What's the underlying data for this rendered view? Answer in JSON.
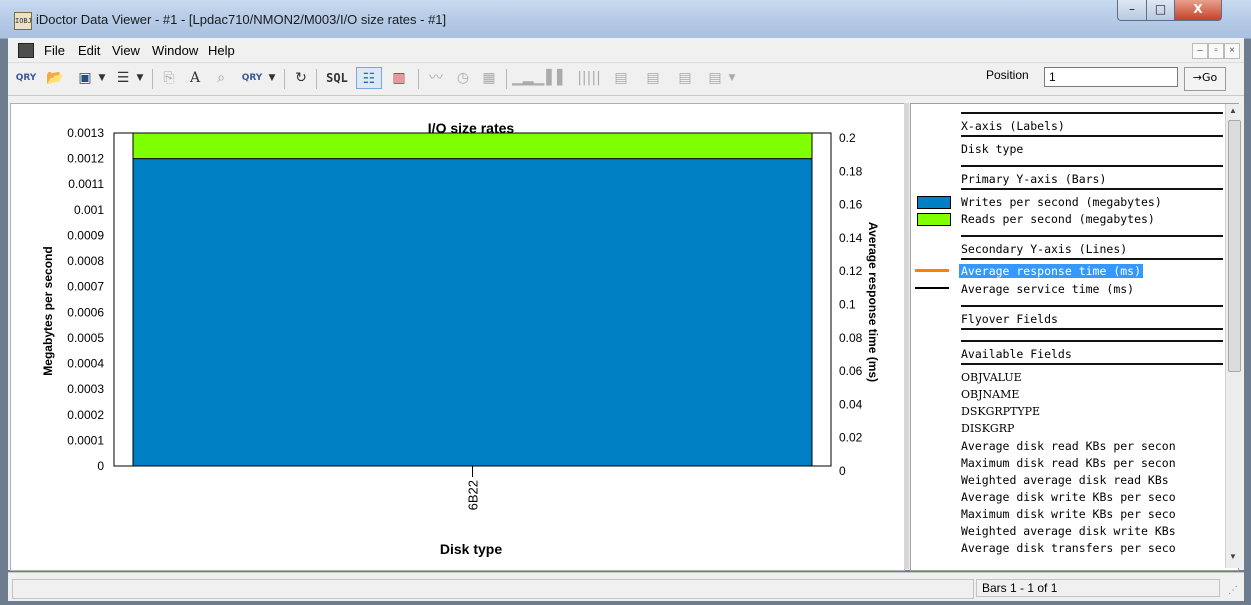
{
  "window": {
    "app_icon_text": "IOBJ",
    "title": "iDoctor Data Viewer - #1 - [Lpdac710/NMON2/M003/I/O size rates - #1]",
    "minimize": "–",
    "maximize": "□",
    "close": "X"
  },
  "menu": [
    "File",
    "Edit",
    "View",
    "Window",
    "Help"
  ],
  "mdi_controls": [
    "–",
    "̅❐",
    "×"
  ],
  "toolbar": {
    "sql_label": "SQL",
    "position_label": "Position",
    "position_value": "1",
    "go_label": "→Go"
  },
  "chart_data": {
    "type": "bar",
    "title": "I/O size rates",
    "categories": [
      "6B22"
    ],
    "series": [
      {
        "name": "Writes per second (megabytes)",
        "values": [
          0.0012
        ],
        "color": "#0080c4"
      },
      {
        "name": "Reads per second (megabytes)",
        "values": [
          0.0001
        ],
        "color": "#80ff00"
      }
    ],
    "stacked": true,
    "xlabel": "Disk type",
    "ylabel": "Megabytes per second",
    "y2label": "Average response time (ms)",
    "ylim": [
      0,
      0.0013
    ],
    "y_ticks": [
      "0",
      "0.0001",
      "0.0002",
      "0.0003",
      "0.0004",
      "0.0005",
      "0.0006",
      "0.0007",
      "0.0008",
      "0.0009",
      "0.001",
      "0.0011",
      "0.0012",
      "0.0013"
    ],
    "y2lim": [
      0,
      0.2
    ],
    "y2_ticks": [
      "0",
      "0.02",
      "0.04",
      "0.06",
      "0.08",
      "0.1",
      "0.12",
      "0.14",
      "0.16",
      "0.18",
      "0.2"
    ],
    "legend_placement": "right panel",
    "grid": false
  },
  "legend": {
    "x_axis_header": "X-axis (Labels)",
    "x_axis_value": "Disk type",
    "primary_header": "Primary Y-axis (Bars)",
    "bar_items": [
      {
        "label": "Writes per second (megabytes)",
        "color": "#0080c4"
      },
      {
        "label": "Reads per second (megabytes)",
        "color": "#80ff00"
      }
    ],
    "secondary_header": "Secondary Y-axis (Lines)",
    "line_items": [
      {
        "label": "Average response time (ms)",
        "color": "#ff8000",
        "selected": true
      },
      {
        "label": "Average service time (ms)",
        "color": "#000000",
        "selected": false
      }
    ],
    "flyover_header": "Flyover Fields",
    "available_header": "Available Fields",
    "available_fields": [
      "OBJVALUE",
      "OBJNAME",
      "DSKGRPTYPE",
      "DISKGRP",
      "Average disk read KBs per secon",
      "Maximum disk read KBs per secon",
      "Weighted average disk read KBs ",
      "Average disk write KBs per seco",
      "Maximum disk write KBs per seco",
      "Weighted average disk write KBs",
      "Average disk transfers per seco"
    ]
  },
  "status": {
    "left": "",
    "right": "Bars 1 - 1 of 1"
  }
}
